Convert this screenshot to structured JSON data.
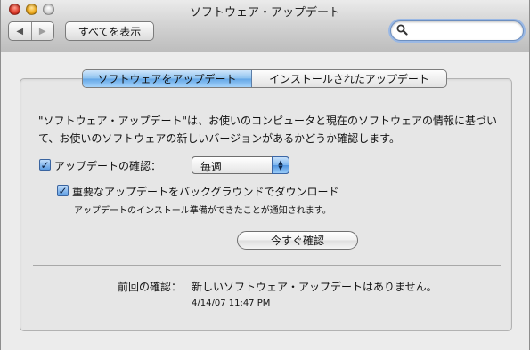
{
  "window": {
    "title": "ソフトウェア・アップデート"
  },
  "toolbar": {
    "back_icon": "back-arrow-icon",
    "forward_icon": "forward-arrow-icon",
    "back_glyph": "◀",
    "forward_glyph": "▶",
    "show_all_label": "すべてを表示",
    "search": {
      "value": "",
      "placeholder": "",
      "icon": "search-icon"
    }
  },
  "tabs": [
    {
      "label": "ソフトウェアをアップデート",
      "selected": true
    },
    {
      "label": "インストールされたアップデート",
      "selected": false
    }
  ],
  "main": {
    "description": "\"ソフトウェア・アップデート\"は、お使いのコンピュータと現在のソフトウェアの情報に基づいて、お使いのソフトウェアの新しいバージョンがあるかどうか確認します。",
    "check_updates": {
      "label": "アップデートの確認：",
      "checked": true
    },
    "frequency": {
      "selected": "毎週"
    },
    "background_download": {
      "label": "重要なアップデートをバックグラウンドでダウンロード",
      "checked": true
    },
    "background_note": "アップデートのインストール準備ができたことが通知されます。",
    "check_now_label": "今すぐ確認",
    "last_check_label": "前回の確認：",
    "last_check_result": "新しいソフトウェア・アップデートはありません。",
    "last_check_time": "4/14/07 11:47 PM"
  },
  "colors": {
    "accent": "#63a6e6",
    "window_bg": "#ececec"
  }
}
